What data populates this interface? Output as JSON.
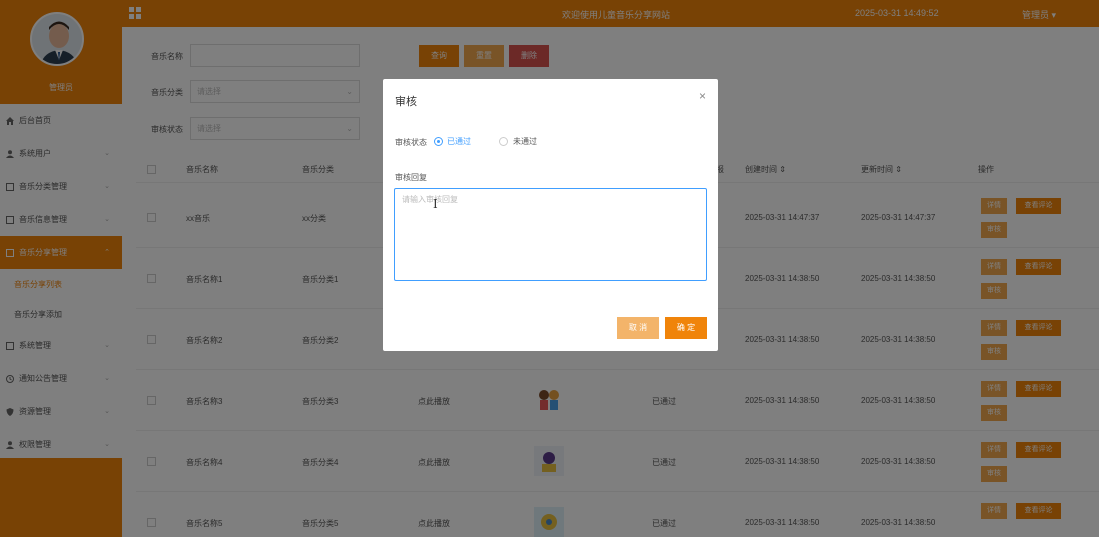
{
  "sidebar": {
    "admin_name": "管理员",
    "menu": [
      {
        "label": "后台首页",
        "icon": "home-icon"
      },
      {
        "label": "系统用户",
        "icon": "user-icon",
        "chevron": "⌄"
      },
      {
        "label": "音乐分类管理",
        "icon": "doc-icon",
        "chevron": "⌄"
      },
      {
        "label": "音乐信息管理",
        "icon": "doc-icon",
        "chevron": "⌄"
      },
      {
        "label": "音乐分享管理",
        "icon": "doc-icon",
        "chevron": "⌃"
      }
    ],
    "submenu": [
      {
        "label": "音乐分享列表"
      },
      {
        "label": "音乐分享添加"
      }
    ],
    "menu2": [
      {
        "label": "系统管理",
        "icon": "doc-icon",
        "chevron": "⌄"
      },
      {
        "label": "通知公告管理",
        "icon": "clock-icon",
        "chevron": "⌄"
      },
      {
        "label": "资源管理",
        "icon": "shield-icon",
        "chevron": "⌄"
      },
      {
        "label": "权限管理",
        "icon": "user-icon",
        "chevron": "⌄"
      }
    ]
  },
  "topbar": {
    "welcome": "欢迎使用儿童音乐分享网站",
    "time": "2025-03-31 14:49:52",
    "user": "管理员 ▾"
  },
  "filters": {
    "name_label": "音乐名称",
    "name_value": "",
    "category_label": "音乐分类",
    "category_placeholder": "请选择",
    "status_label": "审核状态",
    "status_placeholder": "请选择",
    "query": "查询",
    "reset": "重置",
    "delete": "删除"
  },
  "table": {
    "headers": {
      "name": "音乐名称",
      "category": "音乐分类",
      "partial": "报",
      "created": "创建时间 ⇕",
      "updated": "更新时间 ⇕",
      "ops": "操作"
    },
    "rows": [
      {
        "name": "xx音乐",
        "category": "xx分类",
        "play": "",
        "status": "",
        "created": "2025-03-31 14:47:37",
        "updated": "2025-03-31 14:47:37"
      },
      {
        "name": "音乐名称1",
        "category": "音乐分类1",
        "play": "",
        "status": "",
        "created": "2025-03-31 14:38:50",
        "updated": "2025-03-31 14:38:50"
      },
      {
        "name": "音乐名称2",
        "category": "音乐分类2",
        "play": "",
        "status": "",
        "created": "2025-03-31 14:38:50",
        "updated": "2025-03-31 14:38:50"
      },
      {
        "name": "音乐名称3",
        "category": "音乐分类3",
        "play": "点此播放",
        "status": "已通过",
        "created": "2025-03-31 14:38:50",
        "updated": "2025-03-31 14:38:50"
      },
      {
        "name": "音乐名称4",
        "category": "音乐分类4",
        "play": "点此播放",
        "status": "已通过",
        "created": "2025-03-31 14:38:50",
        "updated": "2025-03-31 14:38:50"
      },
      {
        "name": "音乐名称5",
        "category": "音乐分类5",
        "play": "点此播放",
        "status": "已通过",
        "created": "2025-03-31 14:38:50",
        "updated": "2025-03-31 14:38:50"
      }
    ],
    "btn_detail": "详情",
    "btn_comments": "查看评论",
    "btn_audit": "审核"
  },
  "dialog": {
    "title": "审核",
    "close": "×",
    "status_label": "审核状态",
    "option_pass": "已通过",
    "option_fail": "未通过",
    "reply_label": "审核回复",
    "reply_placeholder": "请输入审核回复",
    "cancel": "取 消",
    "ok": "确 定"
  },
  "colors": {
    "accent": "#f0840a",
    "accent_light": "#f3a94f",
    "danger": "#d9534f",
    "focus": "#409eff"
  }
}
